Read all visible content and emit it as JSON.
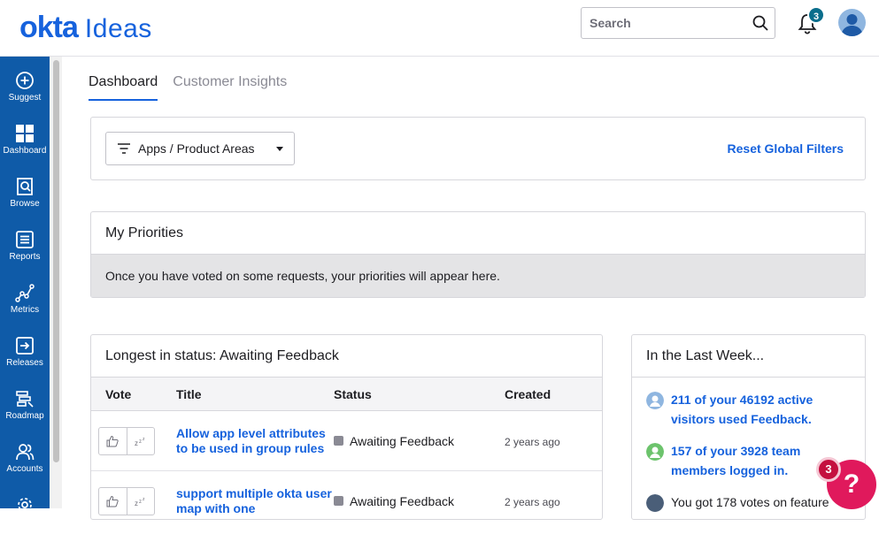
{
  "app": {
    "logo_primary": "okta",
    "logo_secondary": "Ideas"
  },
  "header": {
    "search_placeholder": "Search",
    "notification_count": "3"
  },
  "sidebar": {
    "items": [
      {
        "label": "Suggest",
        "icon": "plus-circle-icon"
      },
      {
        "label": "Dashboard",
        "icon": "grid-icon"
      },
      {
        "label": "Browse",
        "icon": "browse-icon"
      },
      {
        "label": "Reports",
        "icon": "reports-icon"
      },
      {
        "label": "Metrics",
        "icon": "metrics-icon"
      },
      {
        "label": "Releases",
        "icon": "releases-icon"
      },
      {
        "label": "Roadmap",
        "icon": "roadmap-icon"
      },
      {
        "label": "Accounts",
        "icon": "accounts-icon"
      }
    ]
  },
  "tabs": [
    {
      "label": "Dashboard",
      "active": true
    },
    {
      "label": "Customer Insights",
      "active": false
    }
  ],
  "filters": {
    "dropdown_label": "Apps / Product Areas",
    "reset_label": "Reset Global Filters"
  },
  "priorities": {
    "title": "My Priorities",
    "empty_message": "Once you have voted on some requests, your priorities will appear here."
  },
  "longest": {
    "title": "Longest in status: Awaiting Feedback",
    "columns": {
      "vote": "Vote",
      "title": "Title",
      "status": "Status",
      "created": "Created"
    },
    "rows": [
      {
        "title": "Allow app level attributes to be used in group rules",
        "status": "Awaiting Feedback",
        "created": "2 years ago"
      },
      {
        "title": "support multiple okta user map with one",
        "status": "Awaiting Feedback",
        "created": "2 years ago"
      }
    ]
  },
  "last_week": {
    "title": "In the Last Week...",
    "items": [
      {
        "text": "211 of your 46192 active visitors used Feedback."
      },
      {
        "text": "157 of your 3928 team members logged in."
      },
      {
        "text": "You got 178 votes on feature"
      }
    ]
  },
  "help": {
    "label": "?",
    "badge": "3"
  },
  "colors": {
    "brand": "#1662dd",
    "sidebar": "#0f5ba8",
    "help": "#e0195c"
  }
}
